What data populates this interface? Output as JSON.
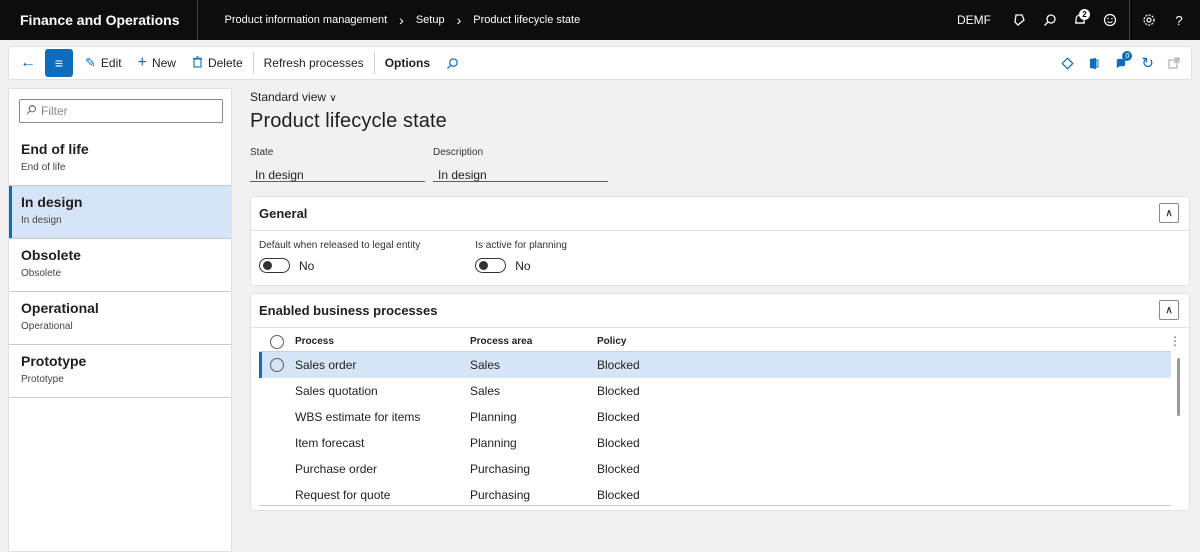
{
  "topbar": {
    "app_name": "Finance and Operations",
    "breadcrumb": [
      "Product information management",
      "Setup",
      "Product lifecycle state"
    ],
    "company": "DEMF",
    "notification_count": "2"
  },
  "actionpane": {
    "edit": "Edit",
    "new": "New",
    "delete": "Delete",
    "refresh": "Refresh processes",
    "options": "Options",
    "attach_count": "0"
  },
  "list": {
    "filter_placeholder": "Filter",
    "items": [
      {
        "title": "End of life",
        "sub": "End of life"
      },
      {
        "title": "In design",
        "sub": "In design"
      },
      {
        "title": "Obsolete",
        "sub": "Obsolete"
      },
      {
        "title": "Operational",
        "sub": "Operational"
      },
      {
        "title": "Prototype",
        "sub": "Prototype"
      }
    ]
  },
  "main": {
    "view": "Standard view",
    "title": "Product lifecycle state",
    "state_label": "State",
    "state_value": "In design",
    "desc_label": "Description",
    "desc_value": "In design"
  },
  "general": {
    "title": "General",
    "default_label": "Default when released to legal entity",
    "default_value": "No",
    "planning_label": "Is active for planning",
    "planning_value": "No"
  },
  "processes": {
    "title": "Enabled business processes",
    "headers": {
      "process": "Process",
      "area": "Process area",
      "policy": "Policy"
    },
    "rows": [
      {
        "process": "Sales order",
        "area": "Sales",
        "policy": "Blocked"
      },
      {
        "process": "Sales quotation",
        "area": "Sales",
        "policy": "Blocked"
      },
      {
        "process": "WBS estimate for items",
        "area": "Planning",
        "policy": "Blocked"
      },
      {
        "process": "Item forecast",
        "area": "Planning",
        "policy": "Blocked"
      },
      {
        "process": "Purchase order",
        "area": "Purchasing",
        "policy": "Blocked"
      },
      {
        "process": "Request for quote",
        "area": "Purchasing",
        "policy": "Blocked"
      }
    ]
  },
  "colors": {
    "accent": "#0f6cbd",
    "selected_bg": "#d6e4f7",
    "topbar_bg": "#0d0d0d"
  }
}
